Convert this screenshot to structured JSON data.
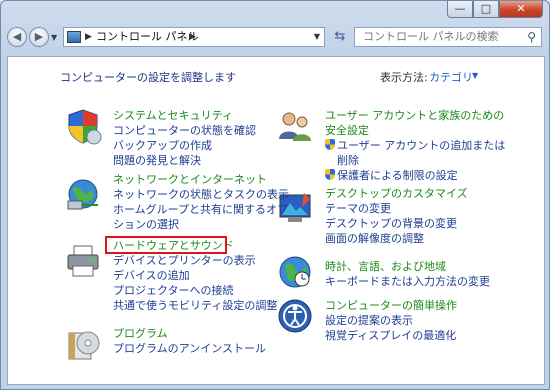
{
  "window": {
    "controls": {
      "minimize": "—",
      "maximize": "□",
      "close": "✕"
    }
  },
  "toolbar": {
    "breadcrumb": "コントロール パネル",
    "search_placeholder": "コントロール パネルの検索"
  },
  "header": {
    "title": "コンピューターの設定を調整します",
    "view_by_label": "表示方法:",
    "view_by_value": "カテゴリ"
  },
  "left_categories": [
    {
      "title": "システムとセキュリティ",
      "icon": "shield-icon",
      "links": [
        "コンピューターの状態を確認",
        "バックアップの作成",
        "問題の発見と解決"
      ]
    },
    {
      "title": "ネットワークとインターネット",
      "icon": "network-globe-icon",
      "links": [
        "ネットワークの状態とタスクの表示",
        "ホームグループと共有に関するオプ",
        "ションの選択"
      ]
    },
    {
      "title": "ハードウェアとサウンド",
      "icon": "printer-icon",
      "links": [
        "デバイスとプリンターの表示",
        "デバイスの追加",
        "プロジェクターへの接続",
        "共通で使うモビリティ設定の調整"
      ]
    },
    {
      "title": "プログラム",
      "icon": "programs-icon",
      "links": [
        "プログラムのアンインストール"
      ]
    }
  ],
  "right_categories": [
    {
      "title_lines": [
        "ユーザー アカウントと家族のための",
        "安全設定"
      ],
      "icon": "users-icon",
      "links": [
        "ユーザー アカウントの追加または",
        "削除",
        "保護者による制限の設定"
      ]
    },
    {
      "title_lines": [
        "デスクトップのカスタマイズ"
      ],
      "icon": "desktop-icon",
      "links": [
        "テーマの変更",
        "デスクトップの背景の変更",
        "画面の解像度の調整"
      ]
    },
    {
      "title_lines": [
        "時計、言語、および地域"
      ],
      "icon": "clock-globe-icon",
      "links": [
        "キーボードまたは入力方法の変更"
      ]
    },
    {
      "title_lines": [
        "コンピューターの簡単操作"
      ],
      "icon": "ease-of-access-icon",
      "links": [
        "設定の提案の表示",
        "視覚ディスプレイの最適化"
      ]
    }
  ],
  "colors": {
    "category_title": "#1a8a1a",
    "link": "#1e3d94",
    "highlight_box": "#e0121b"
  }
}
